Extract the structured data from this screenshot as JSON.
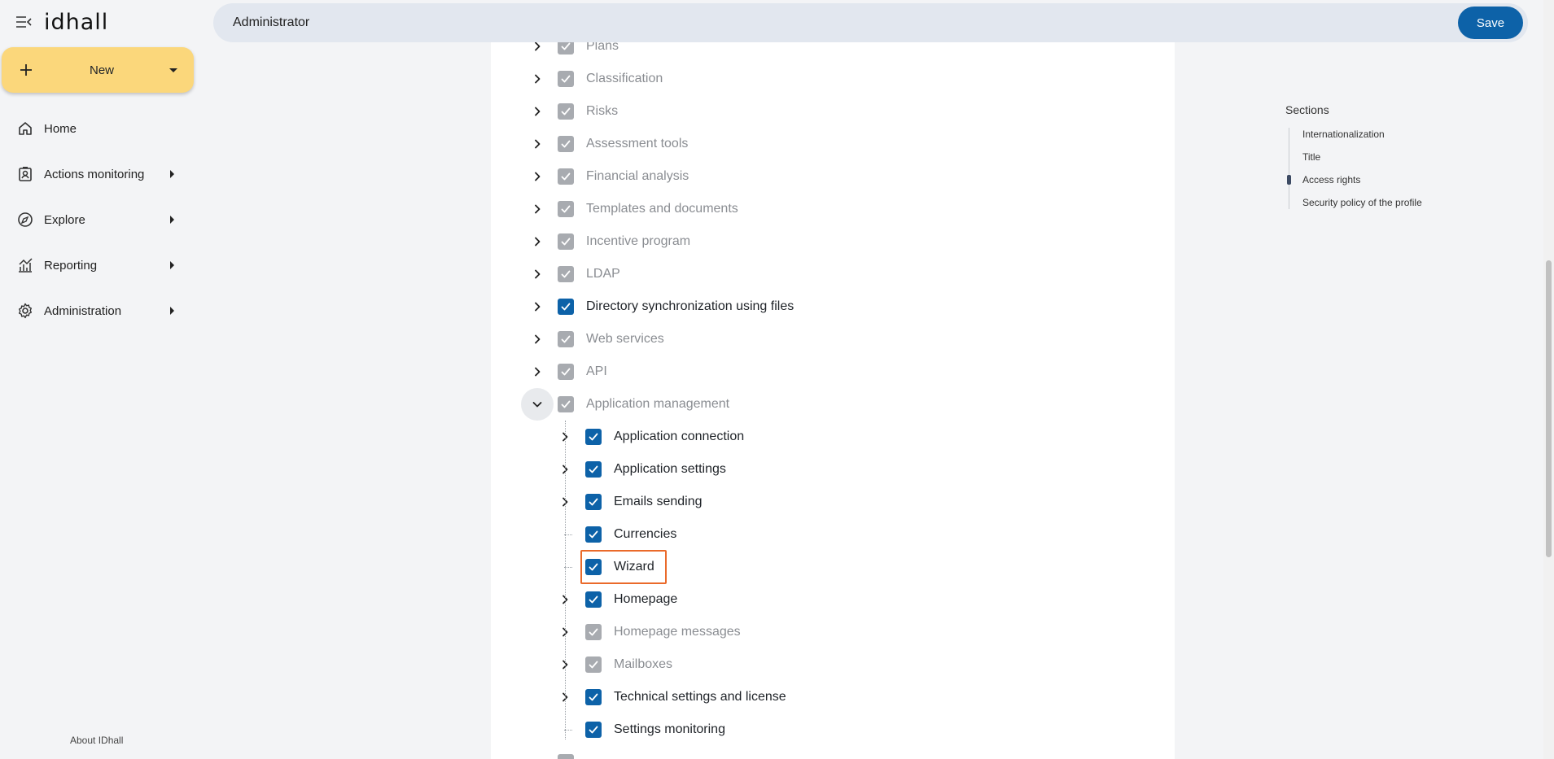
{
  "app": {
    "logo": "idhall"
  },
  "sidebar": {
    "new_label": "New",
    "items": [
      {
        "label": "Home",
        "icon": "home-icon",
        "has_submenu": false
      },
      {
        "label": "Actions monitoring",
        "icon": "clipboard-user-icon",
        "has_submenu": true
      },
      {
        "label": "Explore",
        "icon": "compass-icon",
        "has_submenu": true
      },
      {
        "label": "Reporting",
        "icon": "chart-icon",
        "has_submenu": true
      },
      {
        "label": "Administration",
        "icon": "gear-icon",
        "has_submenu": true
      }
    ],
    "about_label": "About IDhall"
  },
  "header": {
    "title": "Administrator",
    "save_label": "Save"
  },
  "tree": {
    "top_items": [
      {
        "label": "Plans",
        "state": "disabled",
        "expandable": true
      },
      {
        "label": "Classification",
        "state": "disabled",
        "expandable": true
      },
      {
        "label": "Risks",
        "state": "disabled",
        "expandable": true
      },
      {
        "label": "Assessment tools",
        "state": "disabled",
        "expandable": true
      },
      {
        "label": "Financial analysis",
        "state": "disabled",
        "expandable": true
      },
      {
        "label": "Templates and documents",
        "state": "disabled",
        "expandable": true
      },
      {
        "label": "Incentive program",
        "state": "disabled",
        "expandable": true
      },
      {
        "label": "LDAP",
        "state": "disabled",
        "expandable": true
      },
      {
        "label": "Directory synchronization using files",
        "state": "checked",
        "expandable": true
      },
      {
        "label": "Web services",
        "state": "disabled",
        "expandable": true
      },
      {
        "label": "API",
        "state": "disabled",
        "expandable": true
      },
      {
        "label": "Application management",
        "state": "disabled",
        "expandable": true,
        "expanded": true
      }
    ],
    "children": [
      {
        "label": "Application connection",
        "state": "checked",
        "expandable": true
      },
      {
        "label": "Application settings",
        "state": "checked",
        "expandable": true
      },
      {
        "label": "Emails sending",
        "state": "checked",
        "expandable": true
      },
      {
        "label": "Currencies",
        "state": "checked",
        "expandable": false
      },
      {
        "label": "Wizard",
        "state": "checked",
        "expandable": false,
        "highlighted": true
      },
      {
        "label": "Homepage",
        "state": "checked",
        "expandable": true
      },
      {
        "label": "Homepage messages",
        "state": "disabled",
        "expandable": true
      },
      {
        "label": "Mailboxes",
        "state": "disabled",
        "expandable": true
      },
      {
        "label": "Technical settings and license",
        "state": "checked",
        "expandable": true
      },
      {
        "label": "Settings monitoring",
        "state": "checked",
        "expandable": false
      }
    ]
  },
  "sections": {
    "title": "Sections",
    "items": [
      {
        "label": "Internationalization",
        "active": false
      },
      {
        "label": "Title",
        "active": false
      },
      {
        "label": "Access rights",
        "active": true
      },
      {
        "label": "Security policy of the profile",
        "active": false
      }
    ]
  },
  "colors": {
    "accent": "#0d62a8",
    "new_button": "#fbd77b",
    "highlight": "#ea6a2a",
    "disabled": "#a8abb0"
  }
}
